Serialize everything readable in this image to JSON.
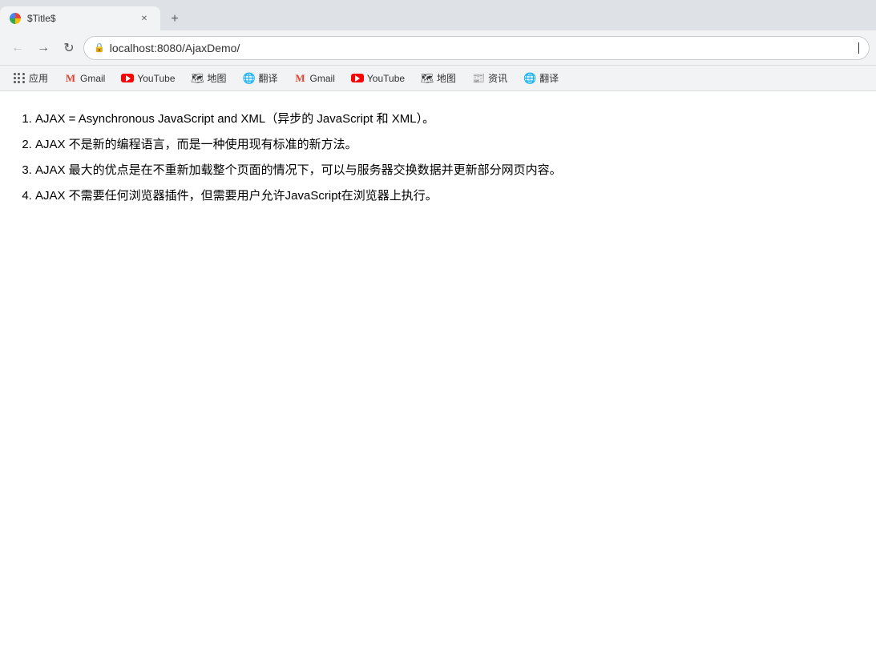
{
  "browser": {
    "tab": {
      "title": "$Title$",
      "url": "localhost:8080/AjaxDemo/"
    },
    "new_tab_label": "+"
  },
  "toolbar": {
    "back_label": "←",
    "forward_label": "→",
    "reload_label": "↻",
    "url": "localhost:8080/AjaxDemo/"
  },
  "bookmarks": [
    {
      "id": "apps",
      "label": "应用",
      "type": "apps"
    },
    {
      "id": "gmail1",
      "label": "Gmail",
      "type": "gmail"
    },
    {
      "id": "youtube1",
      "label": "YouTube",
      "type": "youtube"
    },
    {
      "id": "maps1",
      "label": "地图",
      "type": "maps"
    },
    {
      "id": "translate1",
      "label": "翻译",
      "type": "translate"
    },
    {
      "id": "gmail2",
      "label": "Gmail",
      "type": "gmail"
    },
    {
      "id": "youtube2",
      "label": "YouTube",
      "type": "youtube"
    },
    {
      "id": "maps2",
      "label": "地图",
      "type": "maps"
    },
    {
      "id": "news1",
      "label": "资讯",
      "type": "news"
    },
    {
      "id": "translate2",
      "label": "翻译",
      "type": "translate"
    }
  ],
  "content": {
    "items": [
      "AJAX = Asynchronous JavaScript and XML（异步的 JavaScript 和 XML）。",
      "AJAX 不是新的编程语言，而是一种使用现有标准的新方法。",
      "AJAX 最大的优点是在不重新加载整个页面的情况下，可以与服务器交换数据并更新部分网页内容。",
      "AJAX 不需要任何浏览器插件，但需要用户允许JavaScript在浏览器上执行。"
    ]
  }
}
